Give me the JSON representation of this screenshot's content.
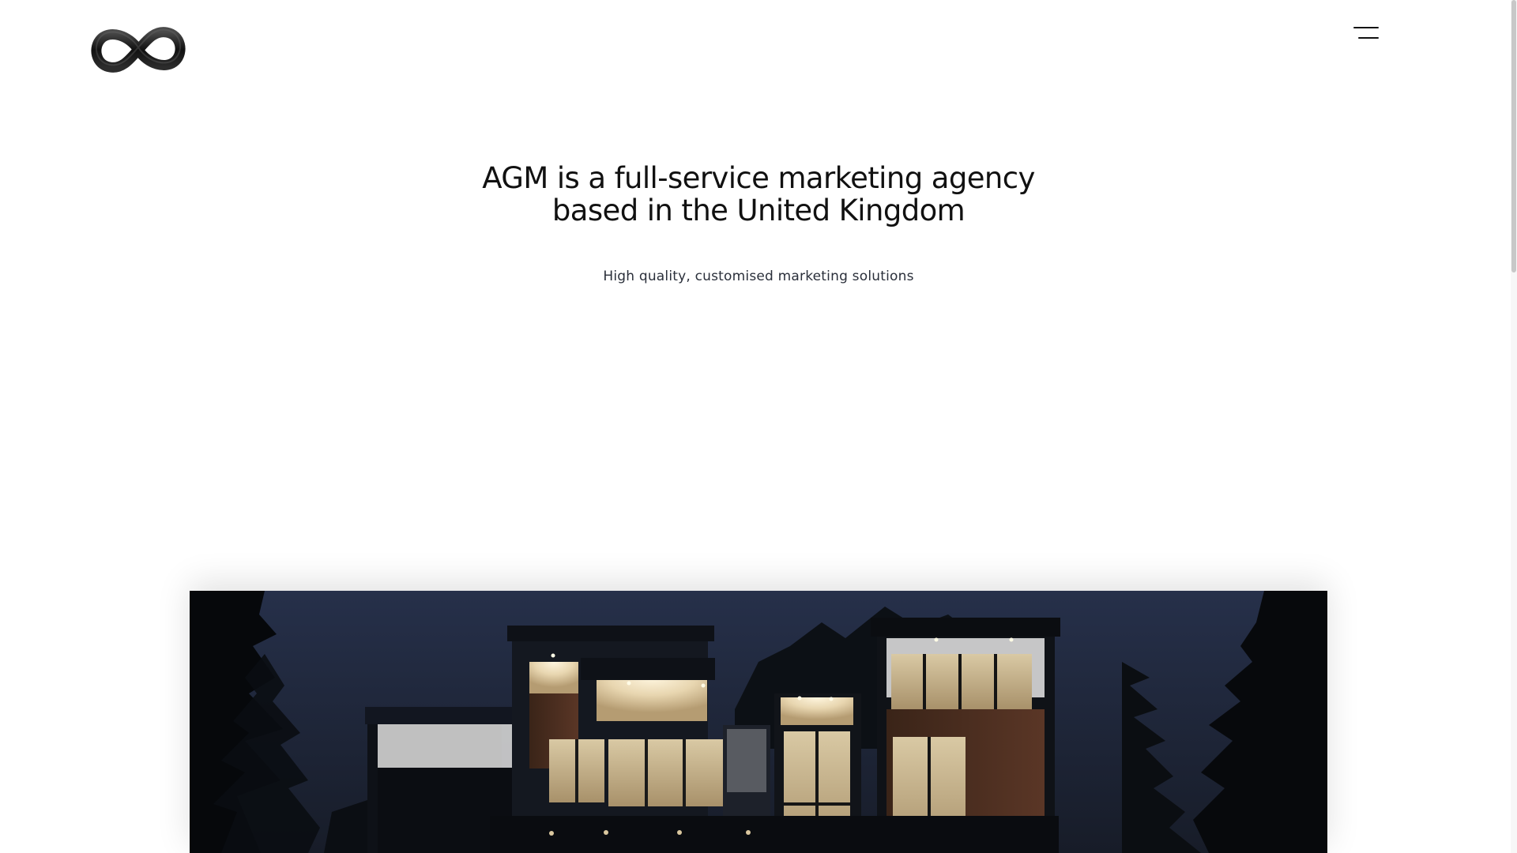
{
  "header": {
    "logo_icon": "infinity-logo",
    "menu_icon": "hamburger-menu-icon"
  },
  "hero": {
    "title": "AGM is a full-service marketing agency based in the United Kingdom",
    "subtitle": "High quality, customised marketing solutions"
  },
  "media": {
    "image_subject": "modern-house-at-night"
  },
  "colors": {
    "background": "#ffffff",
    "text": "#111111",
    "subtitle": "#2a2f3a",
    "night_sky": "#1b2130"
  }
}
